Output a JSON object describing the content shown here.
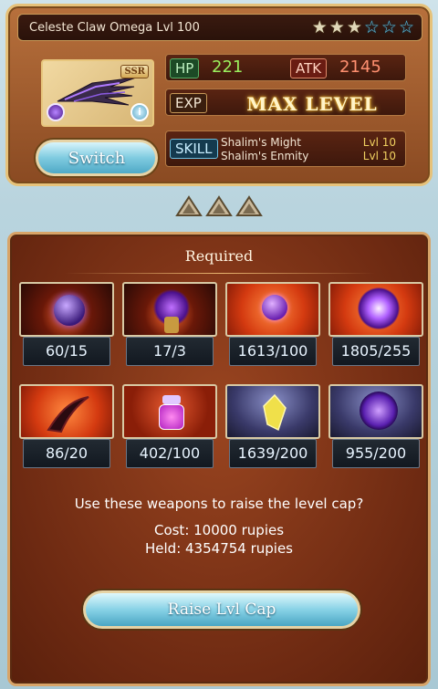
{
  "weapon": {
    "name": "Celeste Claw Omega Lvl 100",
    "stars": {
      "filled": 3,
      "total": 6
    },
    "rarity": "SSR",
    "hp_label": "HP",
    "hp": "221",
    "atk_label": "ATK",
    "atk": "2145",
    "exp_label": "EXP",
    "exp_value": "MAX LEVEL",
    "skill_label": "SKILL",
    "skills": [
      {
        "name": "Shalim's Might",
        "level": "Lvl  10"
      },
      {
        "name": "Shalim's Enmity",
        "level": "Lvl  10"
      }
    ],
    "switch_label": "Switch",
    "element_icon": "dark-element-icon",
    "info_icon": "info-icon"
  },
  "panel": {
    "title": "Required",
    "materials": [
      {
        "icon": "dark-orb-icon",
        "count": "60/15"
      },
      {
        "icon": "dark-whorl-icon",
        "count": "17/3"
      },
      {
        "icon": "inferno-orb-icon",
        "count": "1613/100"
      },
      {
        "icon": "dark-quartz-icon",
        "count": "1805/255"
      },
      {
        "icon": "claw-icon",
        "count": "86/20"
      },
      {
        "icon": "potion-icon",
        "count": "402/100"
      },
      {
        "icon": "crystal-icon",
        "count": "1639/200"
      },
      {
        "icon": "dark-scroll-icon",
        "count": "955/200"
      }
    ],
    "question": "Use these weapons to raise the level cap?",
    "cost": "Cost: 10000 rupies",
    "held": "Held: 4354754 rupies",
    "raise_label": "Raise Lvl Cap"
  },
  "colors": {
    "hp": "#9aef5e",
    "atk": "#ff9070",
    "button": "#7fcbe0",
    "panel": "#8a3a1a"
  }
}
